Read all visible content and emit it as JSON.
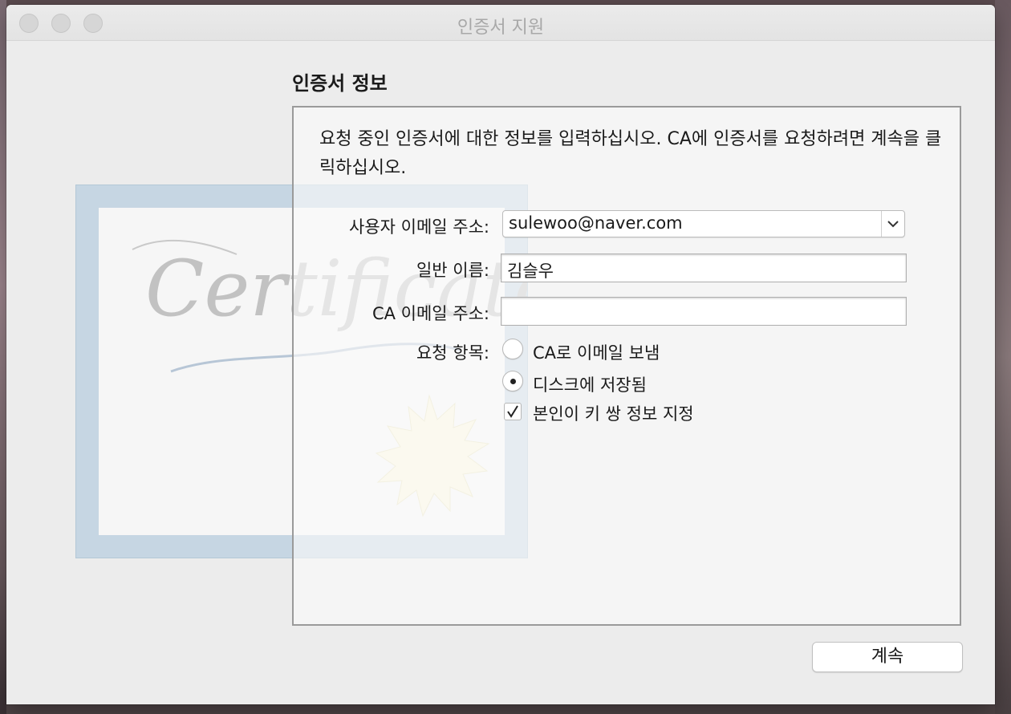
{
  "window": {
    "title": "인증서 지원"
  },
  "page": {
    "section_title": "인증서 정보",
    "intro": "요청 중인 인증서에 대한 정보를 입력하십시오. CA에 인증서를 요청하려면 계속을 클릭하십시오.",
    "illustration_text": "Certificate"
  },
  "form": {
    "email_label": "사용자 이메일 주소:",
    "email_value": "sulewoo@naver.com",
    "common_name_label": "일반 이름:",
    "common_name_value": "김슬우",
    "ca_email_label": "CA 이메일 주소:",
    "ca_email_value": "",
    "request_label": "요청 항목:",
    "options": [
      {
        "label": "CA로 이메일 보냄",
        "selected": false
      },
      {
        "label": "디스크에 저장됨",
        "selected": true
      }
    ],
    "keypair_label": "본인이 키 쌍 정보 지정",
    "keypair_checked": true
  },
  "buttons": {
    "continue": "계속"
  },
  "icons": [
    "close-icon",
    "minimize-icon",
    "zoom-icon",
    "chevron-down-icon",
    "checkmark-icon",
    "certificate-illustration"
  ]
}
